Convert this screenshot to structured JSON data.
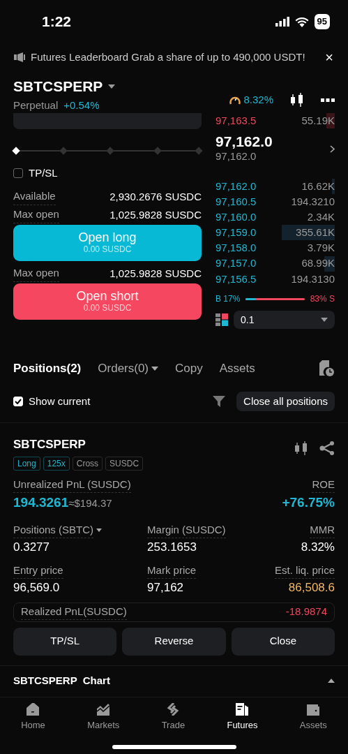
{
  "status_bar": {
    "time": "1:22",
    "battery": "95"
  },
  "banner": {
    "text": "Futures Leaderboard Grab a share of up to 490,000 USDT!",
    "close": "×"
  },
  "header": {
    "symbol": "SBTCSPERP",
    "type": "Perpetual",
    "change": "+0.54%",
    "funding": "8.32%"
  },
  "order_form": {
    "leverage_slider": {
      "level": 0
    },
    "tpsl": {
      "label": "TP/SL",
      "checked": false
    },
    "items": [
      {
        "kind": "info",
        "label": "Available",
        "value": "2,930.2676 SUSDC"
      },
      {
        "kind": "info",
        "label": "Max open",
        "value": "1,025.9828 SUSDC"
      },
      {
        "kind": "long",
        "label": "Open long",
        "sub": "0.00 SUSDC"
      },
      {
        "kind": "info",
        "label": "Max open",
        "value": "1,025.9828 SUSDC"
      },
      {
        "kind": "short",
        "label": "Open short",
        "sub": "0.00 SUSDC"
      }
    ]
  },
  "order_book": {
    "asks": [
      {
        "price": "97,163.5",
        "amount": "55.19K"
      }
    ],
    "last_price": "97,162.0",
    "mark_price": "97,162.0",
    "bids": [
      {
        "price": "97,162.0",
        "amount": "16.62K"
      },
      {
        "price": "97,160.5",
        "amount": "194.3210"
      },
      {
        "price": "97,160.0",
        "amount": "2.34K"
      },
      {
        "price": "97,159.0",
        "amount": "355.61K"
      },
      {
        "price": "97,158.0",
        "amount": "3.79K"
      },
      {
        "price": "97,157.0",
        "amount": "68.99K"
      },
      {
        "price": "97,156.5",
        "amount": "194.3130"
      }
    ],
    "ratio": {
      "buy": "B 17%",
      "sell": "83% S",
      "level": 0.17
    },
    "depth": "0.1"
  },
  "tabs": [
    {
      "label": "Positions(2)",
      "selected": true,
      "dropdown": false
    },
    {
      "label": "Orders(0)",
      "selected": false,
      "dropdown": true
    },
    {
      "label": "Copy",
      "selected": false,
      "dropdown": false
    },
    {
      "label": "Assets",
      "selected": false,
      "dropdown": false
    }
  ],
  "show_current": {
    "label": "Show current",
    "checked": true
  },
  "close_all": "Close all positions",
  "position": {
    "symbol": "SBTCSPERP",
    "tags": [
      {
        "label": "Long",
        "color": "#22b5cc"
      },
      {
        "label": "125x",
        "color": "#22b5cc"
      },
      {
        "label": "Cross",
        "color": "#9a9a9a"
      },
      {
        "label": "SUSDC",
        "color": "#9a9a9a"
      }
    ],
    "pnl_label": "Unrealized PnL (SUSDC)",
    "pnl": "194.3261",
    "pnl_usd": "≈$194.37",
    "roe_label": "ROE",
    "roe": "+76.75%",
    "stats": [
      {
        "label": "Positions (SBTC)",
        "value": "0.3277",
        "dropdown": true,
        "color": "#ffffff"
      },
      {
        "label": "Margin (SUSDC)",
        "value": "253.1653",
        "dropdown": false,
        "color": "#ffffff"
      },
      {
        "label": "MMR",
        "value": "8.32%",
        "dropdown": false,
        "color": "#ffffff"
      },
      {
        "label": "Entry price",
        "value": "96,569.0",
        "dropdown": false,
        "color": "#ffffff"
      },
      {
        "label": "Mark price",
        "value": "97,162",
        "dropdown": false,
        "color": "#ffffff"
      },
      {
        "label": "Est. liq. price",
        "value": "86,508.6",
        "dropdown": false,
        "color": "#f4b862"
      }
    ],
    "realized_label": "Realized PnL(SUSDC)",
    "realized": "-18.9874",
    "actions": [
      "TP/SL",
      "Reverse",
      "Close"
    ]
  },
  "chart_section": {
    "title": "SBTCSPERP  Chart"
  },
  "nav": [
    {
      "label": "Home",
      "selected": false
    },
    {
      "label": "Markets",
      "selected": false
    },
    {
      "label": "Trade",
      "selected": false
    },
    {
      "label": "Futures",
      "selected": true
    },
    {
      "label": "Assets",
      "selected": false
    }
  ]
}
